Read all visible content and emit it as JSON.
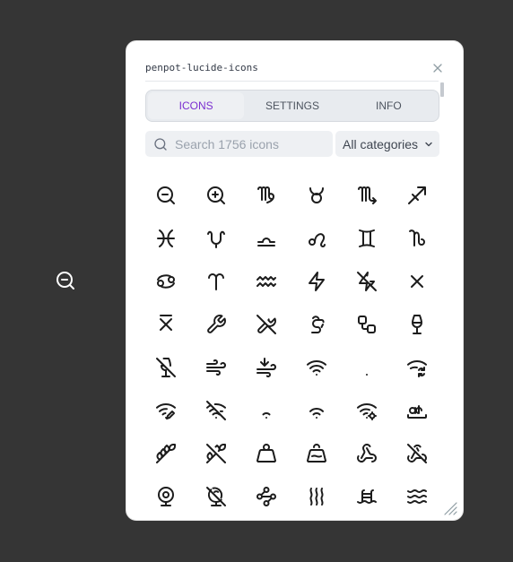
{
  "plugin": {
    "title": "penpot-lucide-icons",
    "tabs": [
      {
        "label": "ICONS",
        "active": true
      },
      {
        "label": "SETTINGS",
        "active": false
      },
      {
        "label": "INFO",
        "active": false
      }
    ],
    "search": {
      "placeholder": "Search 1756 icons",
      "value": ""
    },
    "category": {
      "selected": "All categories"
    }
  },
  "colors": {
    "accent": "#7b2fd0",
    "canvas": "#353535",
    "icon": "#1c1c1c"
  },
  "icons": [
    "zoom-out-icon",
    "zoom-in-icon",
    "virgo-icon",
    "taurus-icon",
    "scorpio-icon",
    "sagittarius-icon",
    "pisces-icon",
    "ophiuchus-icon",
    "libra-icon",
    "leo-icon",
    "gemini-icon",
    "capricorn-icon",
    "cancer-icon",
    "aries-icon",
    "aquarius-icon",
    "zap-icon",
    "zap-off-icon",
    "x-icon",
    "x-line-top-icon",
    "wrench-icon",
    "wrench-off-icon",
    "worm-icon",
    "workflow-icon",
    "wine-icon",
    "wine-off-icon",
    "wind-icon",
    "wind-arrow-down-icon",
    "wifi-icon",
    "wifi-zero-icon",
    "wifi-sync-icon",
    "wifi-pen-icon",
    "wifi-off-icon",
    "wifi-low-icon",
    "wifi-high-icon",
    "wifi-cog-icon",
    "whole-word-icon",
    "wheat-icon",
    "wheat-off-icon",
    "weight-icon",
    "weight-tilde-icon",
    "webhook-icon",
    "webhook-off-icon",
    "webcam-icon",
    "web-cam-off-icon",
    "waypoints-icon",
    "waves-icon",
    "waves-ladder-icon",
    "waves-horizontal-icon"
  ]
}
